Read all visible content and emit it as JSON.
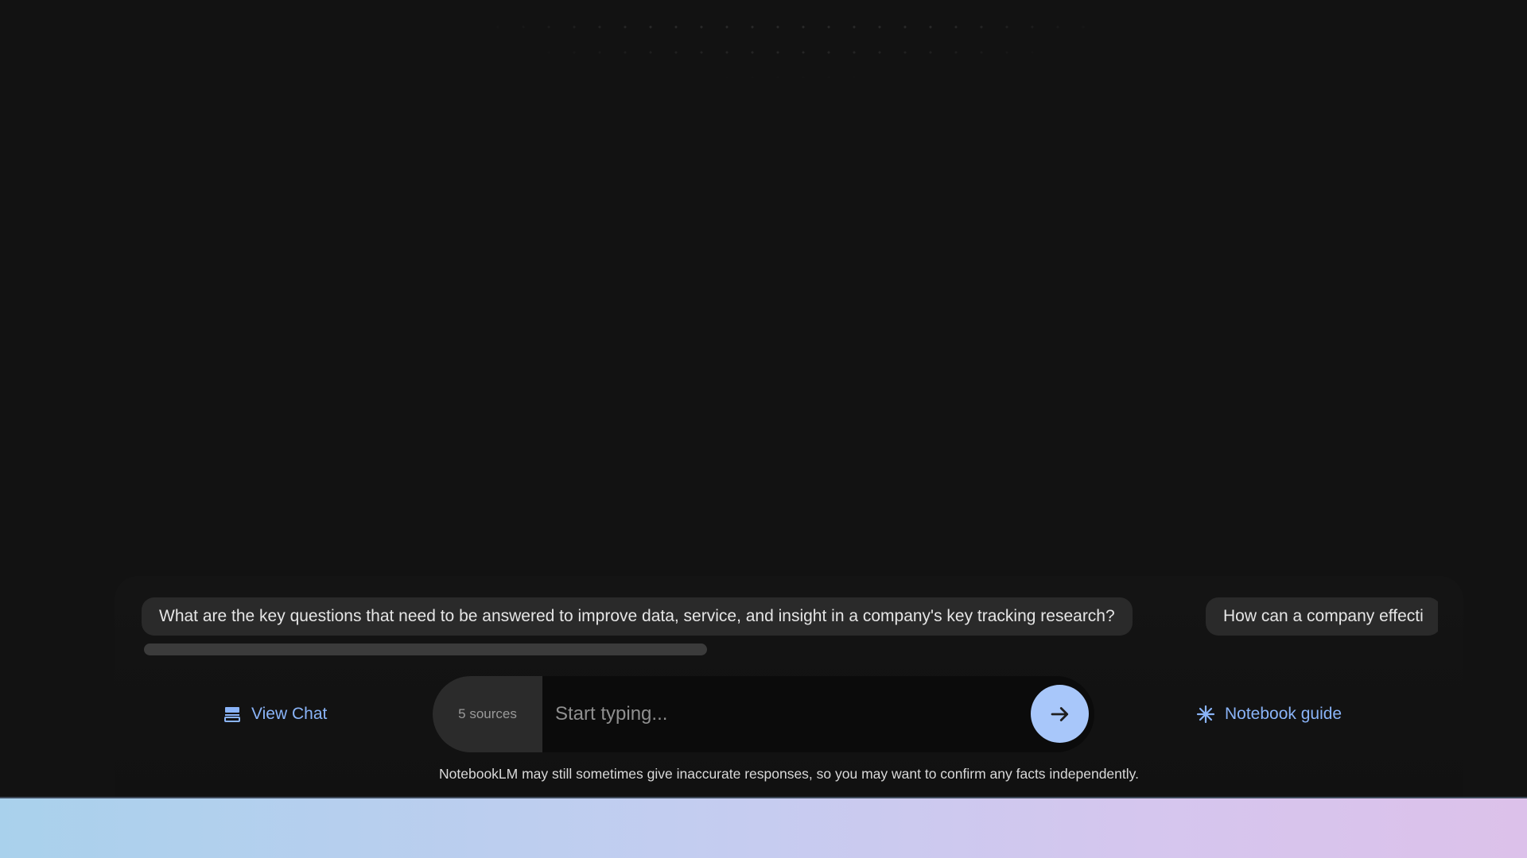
{
  "suggestions": [
    "What are the key questions that need to be answered to improve data, service, and insight in a company's key tracking research?",
    "How can a company effecti"
  ],
  "view_chat": {
    "label": "View Chat",
    "icon": "chat-icon"
  },
  "composer": {
    "sources_label": "5 sources",
    "placeholder": "Start typing...",
    "value": "",
    "send_icon": "arrow-right-icon"
  },
  "notebook_guide": {
    "label": "Notebook guide",
    "icon": "sparkle-icon"
  },
  "disclaimer": "NotebookLM may still sometimes give inaccurate responses, so you may want to confirm any facts independently.",
  "colors": {
    "background": "#121212",
    "accent": "#8ab4f8",
    "send_button": "#a8c7fa",
    "chip": "#2a2a2a"
  }
}
